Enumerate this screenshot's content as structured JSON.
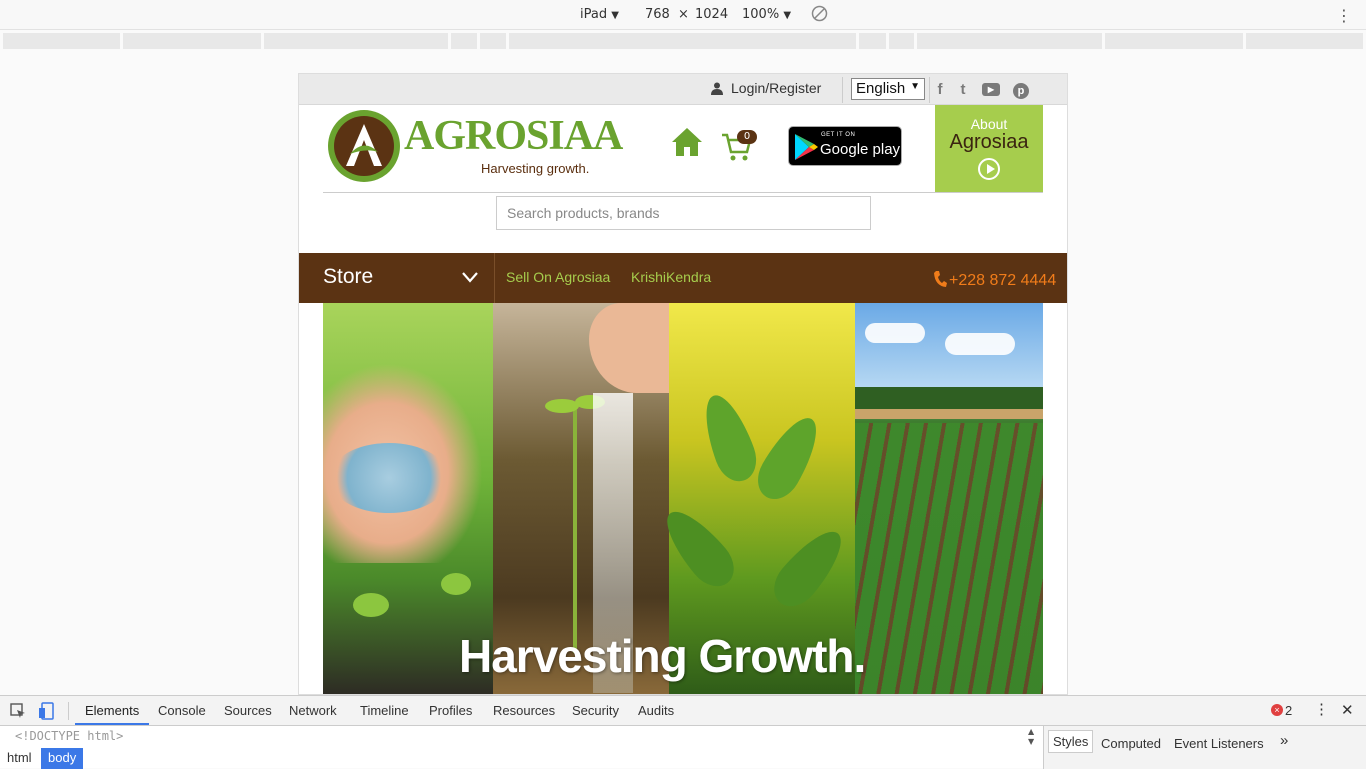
{
  "device_toolbar": {
    "device": "iPad",
    "device_arrow": "▼",
    "width": "768",
    "times": "×",
    "height": "1024",
    "zoom": "100%",
    "zoom_arrow": "▼",
    "rotate_icon": "rotate-icon",
    "menu_icon": "kebab-menu-icon"
  },
  "site": {
    "topbar": {
      "login_label": "Login/Register",
      "language": "English",
      "language_arrow": "▼",
      "social": [
        {
          "name": "facebook-icon",
          "glyph": "f"
        },
        {
          "name": "twitter-icon",
          "glyph": "t"
        },
        {
          "name": "youtube-icon",
          "glyph": "▶"
        },
        {
          "name": "pinterest-icon",
          "glyph": "p"
        }
      ]
    },
    "logo": {
      "brand": "AGROSIAA",
      "tagline": "Harvesting growth."
    },
    "cart_count": "0",
    "google_play": {
      "small": "GET IT ON",
      "big": "Google play"
    },
    "about": {
      "line1": "About",
      "line2": "Agrosiaa"
    },
    "search": {
      "placeholder": "Search products, brands",
      "value": ""
    },
    "nav": {
      "store": "Store",
      "links": [
        "Sell On Agrosiaa",
        "KrishiKendra"
      ],
      "phone": "+228 872 4444"
    },
    "hero": {
      "caption": "Harvesting Growth."
    },
    "colors": {
      "brand_green": "#6aa32f",
      "brand_brown": "#5b3313",
      "about_bg": "#a6cd4d",
      "phone_orange": "#f07c1a"
    }
  },
  "devtools": {
    "tabs": [
      "Elements",
      "Console",
      "Sources",
      "Network",
      "Timeline",
      "Profiles",
      "Resources",
      "Security",
      "Audits"
    ],
    "more": "»",
    "error_count": "2",
    "doctype": "<!DOCTYPE html>",
    "breadcrumbs": [
      "html",
      "body"
    ],
    "side_tabs": [
      "Styles",
      "Computed",
      "Event Listeners"
    ],
    "side_more": "»"
  }
}
